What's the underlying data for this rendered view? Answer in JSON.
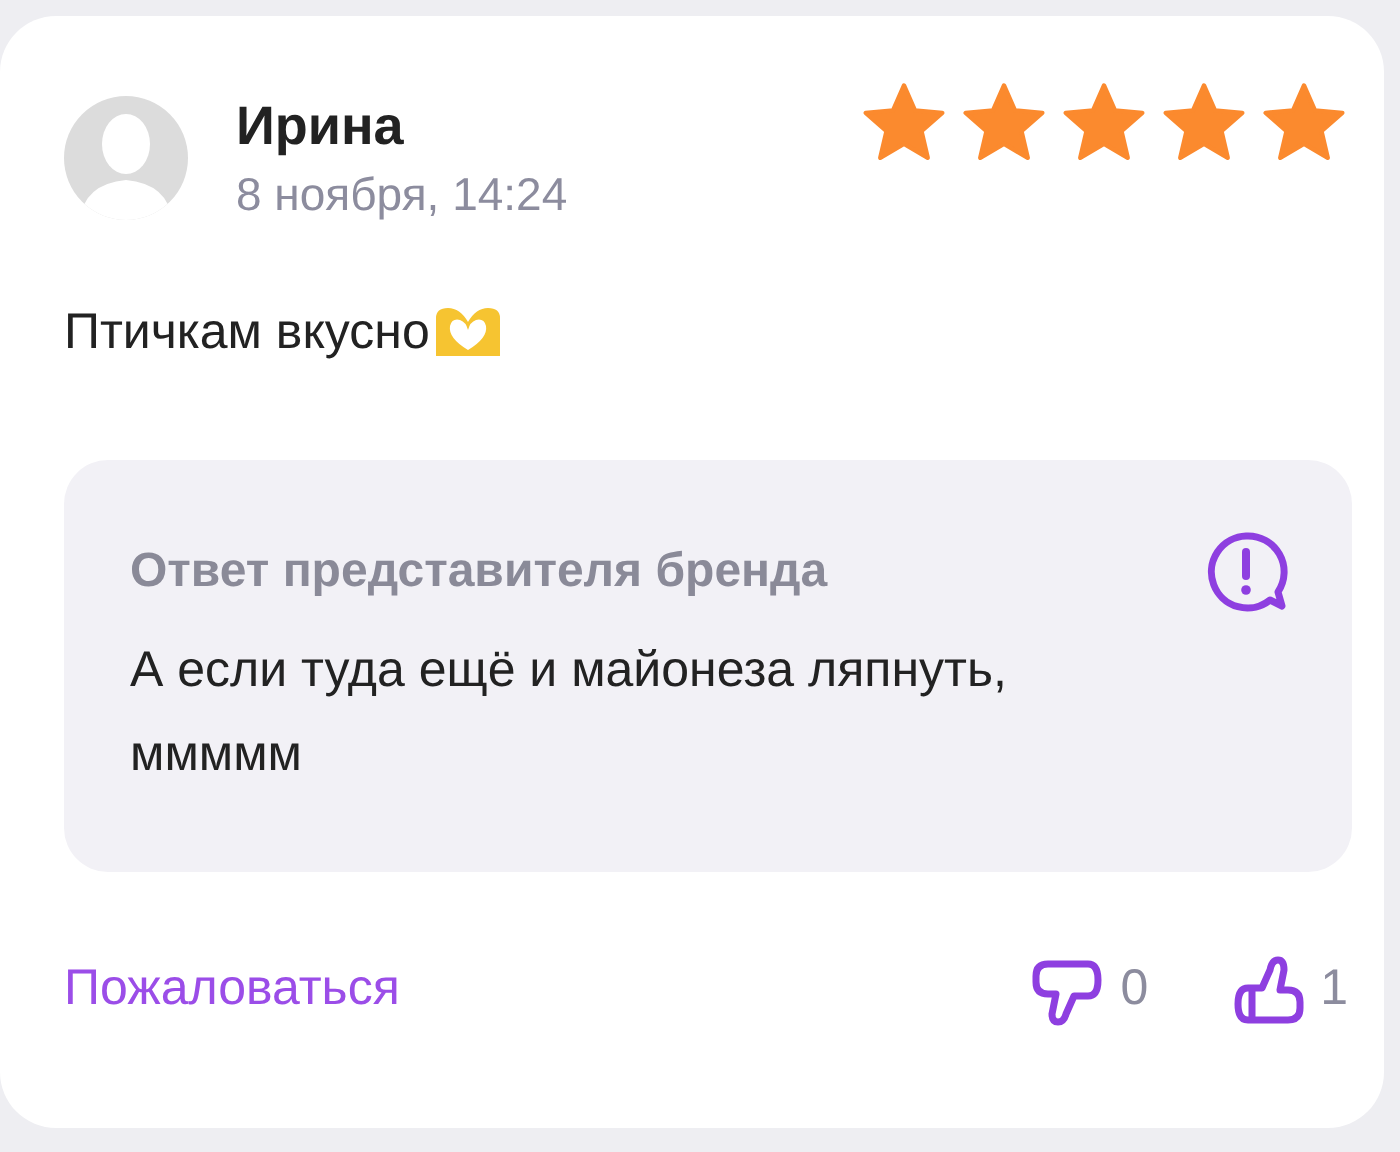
{
  "review": {
    "author": "Ирина",
    "date": "8 ноября, 14:24",
    "stars": 5,
    "text": "Птичкам вкусно"
  },
  "brand_reply": {
    "title": "Ответ представителя бренда",
    "text": "А если туда ещё и майонеза ляпнуть, ммммм"
  },
  "footer": {
    "report_link": "Пожаловаться",
    "dislikes": "0",
    "likes": "1"
  }
}
